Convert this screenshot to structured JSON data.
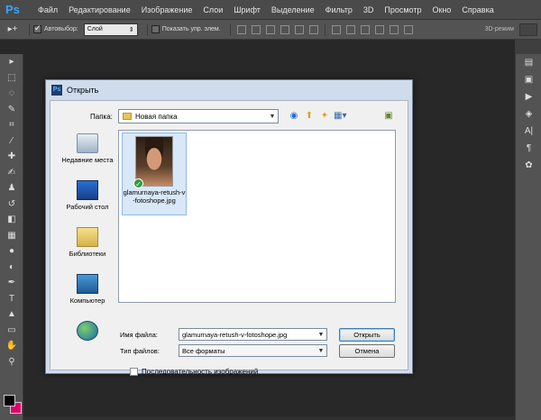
{
  "app": {
    "logo": "Ps"
  },
  "menu": [
    "Файл",
    "Редактирование",
    "Изображение",
    "Слои",
    "Шрифт",
    "Выделение",
    "Фильтр",
    "3D",
    "Просмотр",
    "Окно",
    "Справка"
  ],
  "options": {
    "autoselect_label": "Автовыбор:",
    "autoselect_value": "Слой",
    "show_controls_label": "Показать упр. элем.",
    "mode_3d": "3D-режим"
  },
  "dialog": {
    "title": "Открыть",
    "look_in_label": "Папка:",
    "look_in_value": "Новая папка",
    "places": [
      {
        "label": "Недавние места",
        "icon": "recent-places-icon"
      },
      {
        "label": "Рабочий стол",
        "icon": "desktop-icon"
      },
      {
        "label": "Библиотеки",
        "icon": "libraries-icon"
      },
      {
        "label": "Компьютер",
        "icon": "computer-icon"
      },
      {
        "label": "",
        "icon": "network-icon"
      }
    ],
    "files": [
      {
        "name": "glamurnaya-retush-v-fotoshope.jpg"
      }
    ],
    "filename_label": "Имя файла:",
    "filename_value": "glamurnaya-retush-v-fotoshope.jpg",
    "filetype_label": "Тип файлов:",
    "filetype_value": "Все форматы",
    "open_button": "Открыть",
    "cancel_button": "Отмена",
    "sequence_label": "Последовательность изображений"
  },
  "colors": {
    "foreground": "#000000",
    "background": "#e0006a"
  }
}
